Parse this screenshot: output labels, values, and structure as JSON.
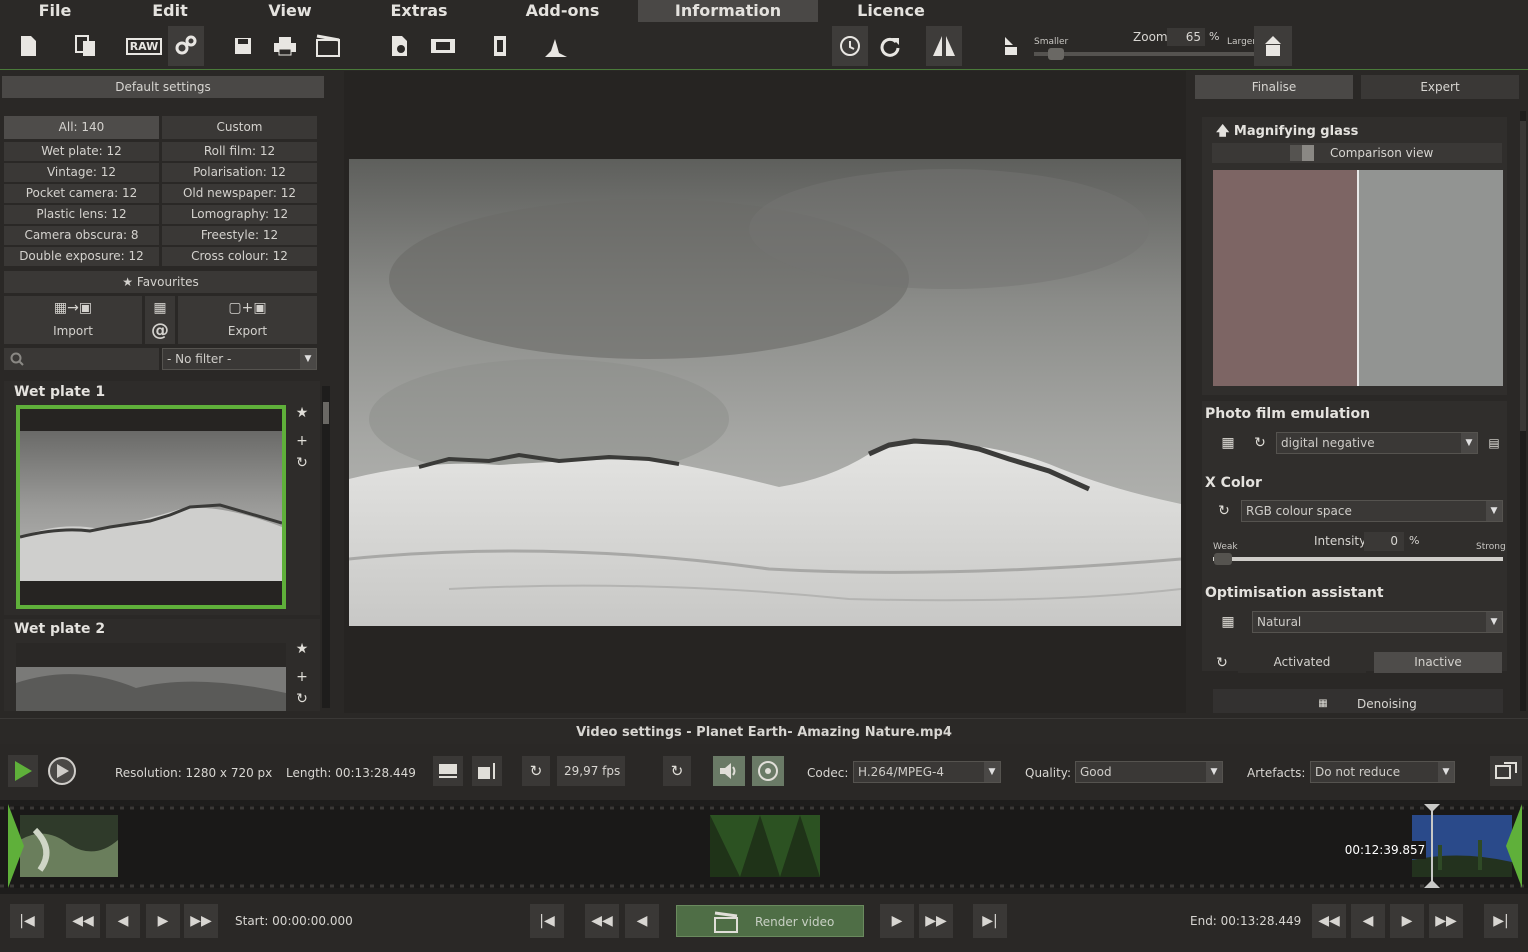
{
  "menu": {
    "file": "File",
    "edit": "Edit",
    "view": "View",
    "extras": "Extras",
    "addons": "Add-ons",
    "information": "Information",
    "licence": "Licence"
  },
  "toolbar": {
    "raw_label": "RAW",
    "zoom_label": "Zoom",
    "zoom_value": "65",
    "zoom_unit": "%",
    "smaller": "Smaller",
    "larger": "Larger"
  },
  "left_panel": {
    "default_settings": "Default settings",
    "tab_all": "All: 140",
    "tab_custom": "Custom",
    "categories_left": [
      "Wet plate: 12",
      "Vintage: 12",
      "Pocket camera: 12",
      "Plastic lens: 12",
      "Camera obscura: 8",
      "Double exposure: 12"
    ],
    "categories_right": [
      "Roll film: 12",
      "Polarisation: 12",
      "Old newspaper: 12",
      "Lomography: 12",
      "Freestyle: 12",
      "Cross colour: 12"
    ],
    "favourites": "Favourites",
    "import": "Import",
    "at_symbol": "@",
    "export": "Export",
    "filter": "- No filter -",
    "presets": [
      {
        "name": "Wet plate 1"
      },
      {
        "name": "Wet plate 2"
      }
    ]
  },
  "right_panel": {
    "tab_finalise": "Finalise",
    "tab_expert": "Expert",
    "magnifying_glass": "Magnifying glass",
    "comparison_view": "Comparison view",
    "photo_film_emulation": "Photo film emulation",
    "film_value": "digital negative",
    "x_color": "X Color",
    "colour_space": "RGB colour space",
    "intensity_label": "Intensity",
    "intensity_value": "0",
    "intensity_unit": "%",
    "weak": "Weak",
    "strong": "Strong",
    "optimisation_assistant": "Optimisation assistant",
    "optimisation_value": "Natural",
    "activated": "Activated",
    "inactive": "Inactive",
    "denoising": "Denoising"
  },
  "video": {
    "title": "Video settings - Planet Earth- Amazing Nature.mp4",
    "resolution": "Resolution: 1280 x 720 px",
    "length": "Length: 00:13:28.449",
    "fps": "29,97 fps",
    "codec_label": "Codec:",
    "codec_value": "H.264/MPEG-4",
    "quality_label": "Quality:",
    "quality_value": "Good",
    "artefacts_label": "Artefacts:",
    "artefacts_value": "Do not reduce",
    "timecode": "00:12:39.857",
    "start": "Start: 00:00:00.000",
    "end": "End: 00:13:28.449",
    "render": "Render video"
  },
  "colors": {
    "accent_green": "#5fb03a",
    "panel_bg": "#2a2826",
    "button_bg": "#4a4846"
  }
}
